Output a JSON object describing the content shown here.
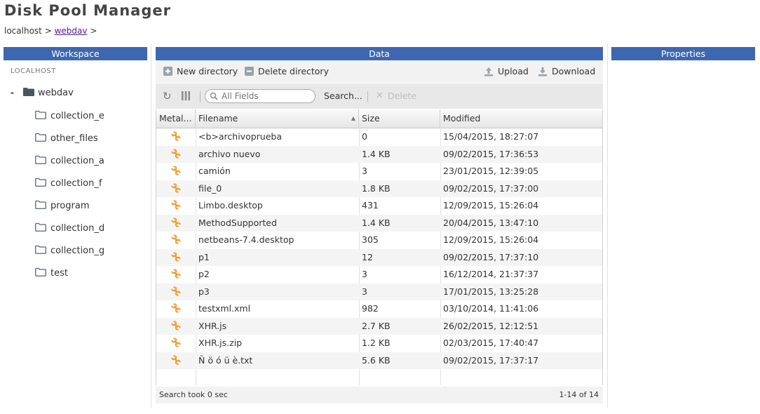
{
  "app": {
    "title": "Disk Pool Manager"
  },
  "breadcrumb": {
    "host": "localhost",
    "sep1": ">",
    "link": "webdav",
    "sep2": ">"
  },
  "panels": {
    "workspace": "Workspace",
    "data": "Data",
    "properties": "Properties"
  },
  "workspace": {
    "root": "LOCALHOST",
    "tree_root": {
      "toggle": "-",
      "label": "webdav",
      "icon": "folder-filled-icon"
    },
    "children": [
      {
        "label": "collection_e",
        "icon": "folder-outline-icon"
      },
      {
        "label": "other_files",
        "icon": "folder-outline-icon"
      },
      {
        "label": "collection_a",
        "icon": "folder-outline-icon"
      },
      {
        "label": "collection_f",
        "icon": "folder-outline-icon"
      },
      {
        "label": "program",
        "icon": "folder-outline-icon"
      },
      {
        "label": "collection_d",
        "icon": "folder-outline-icon"
      },
      {
        "label": "collection_g",
        "icon": "folder-outline-icon"
      },
      {
        "label": "test",
        "icon": "folder-outline-icon"
      }
    ]
  },
  "toolbar": {
    "new_directory": "New directory",
    "delete_directory": "Delete directory",
    "upload": "Upload",
    "download": "Download"
  },
  "filterbar": {
    "search_placeholder": "All Fields",
    "search_label": "Search...",
    "delete_label": "Delete"
  },
  "table": {
    "columns": [
      "Metal...",
      "Filename",
      "Size",
      "Modified"
    ],
    "sorted_column": "Filename",
    "rows": [
      {
        "name": "<b>archivoprueba",
        "size": "0",
        "modified": "15/04/2015, 18:27:07"
      },
      {
        "name": "archivo nuevo",
        "size": "1.4 KB",
        "modified": "09/02/2015, 17:36:53"
      },
      {
        "name": "camión",
        "size": "3",
        "modified": "23/01/2015, 12:39:05"
      },
      {
        "name": "file_0",
        "size": "1.8 KB",
        "modified": "09/02/2015, 17:37:00"
      },
      {
        "name": "Limbo.desktop",
        "size": "431",
        "modified": "12/09/2015, 15:26:04"
      },
      {
        "name": "MethodSupported",
        "size": "1.4 KB",
        "modified": "20/04/2015, 13:47:10"
      },
      {
        "name": "netbeans-7.4.desktop",
        "size": "305",
        "modified": "12/09/2015, 15:26:04"
      },
      {
        "name": "p1",
        "size": "12",
        "modified": "09/02/2015, 17:37:10"
      },
      {
        "name": "p2",
        "size": "3",
        "modified": "16/12/2014, 21:37:37"
      },
      {
        "name": "p3",
        "size": "3",
        "modified": "17/01/2015, 13:25:28"
      },
      {
        "name": "testxml.xml",
        "size": "982",
        "modified": "03/10/2014, 11:41:06"
      },
      {
        "name": "XHR.js",
        "size": "2.7 KB",
        "modified": "26/02/2015, 12:12:51"
      },
      {
        "name": "XHR.js.zip",
        "size": "1.2 KB",
        "modified": "02/03/2015, 17:40:47"
      },
      {
        "name": "Ñ ö ó ü è.txt",
        "size": "5.6 KB",
        "modified": "09/02/2015, 17:37:17"
      }
    ]
  },
  "status": {
    "search_time": "Search took 0 sec",
    "count": "1-14 of 14"
  },
  "colors": {
    "header_blue": "#3d67b0",
    "icon_orange": "#f39c2b",
    "link": "#551a8b"
  }
}
